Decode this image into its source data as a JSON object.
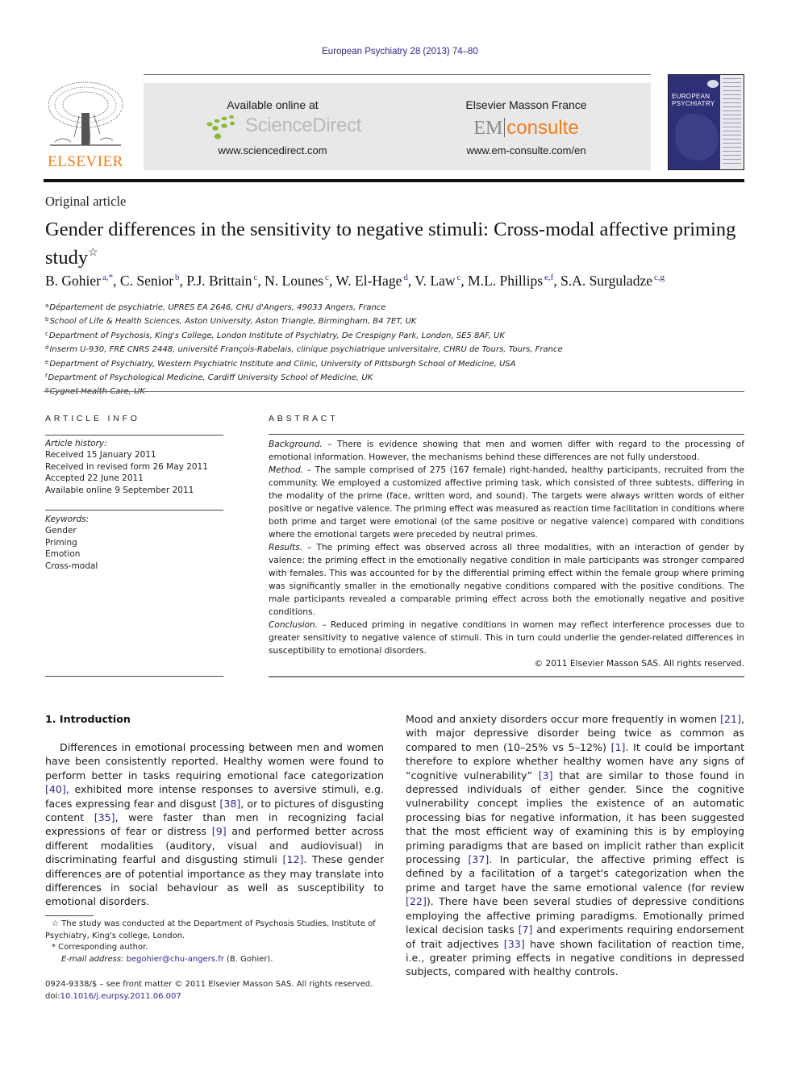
{
  "header": {
    "journal_ref": "European Psychiatry 28 (2013) 74–80",
    "publisher_logo_text": "ELSEVIER",
    "sciencedirect": {
      "available_label": "Available online at",
      "brand": "ScienceDirect",
      "url": "www.sciencedirect.com"
    },
    "emconsulte": {
      "publisher": "Elsevier Masson France",
      "brand_em": "EM",
      "brand_consulte": "consulte",
      "url": "www.em-consulte.com/en"
    },
    "cover": {
      "title_line1": "EUROPEAN",
      "title_line2": "PSYCHIATRY"
    },
    "colors": {
      "link": "#2a2a8c",
      "elsevier_orange": "#f07f1c",
      "banner_bg": "#e8e8e8",
      "cover_bg": "#2e2f77"
    }
  },
  "article": {
    "type": "Original article",
    "title": "Gender differences in the sensitivity to negative stimuli: Cross-modal affective priming study",
    "title_mark": "☆",
    "authors": [
      {
        "name": "B. Gohier",
        "sup": "a,*"
      },
      {
        "name": "C. Senior",
        "sup": "b"
      },
      {
        "name": "P.J. Brittain",
        "sup": "c"
      },
      {
        "name": "N. Lounes",
        "sup": "c"
      },
      {
        "name": "W. El-Hage",
        "sup": "d"
      },
      {
        "name": "V. Law",
        "sup": "c"
      },
      {
        "name": "M.L. Phillips",
        "sup": "e,f"
      },
      {
        "name": "S.A. Surguladze",
        "sup": "c,g"
      }
    ],
    "affiliations": [
      {
        "key": "a",
        "text": "Département de psychiatrie, UPRES EA 2646, CHU d'Angers, 49033 Angers, France"
      },
      {
        "key": "b",
        "text": "School of Life & Health Sciences, Aston University, Aston Triangle, Birmingham, B4 7ET, UK"
      },
      {
        "key": "c",
        "text": "Department of Psychosis, King's College, London Institute of Psychiatry, De Crespigny Park, London, SE5 8AF, UK"
      },
      {
        "key": "d",
        "text": "Inserm U-930, FRE CNRS 2448, université François-Rabelais, clinique psychiatrique universitaire, CHRU de Tours, Tours, France"
      },
      {
        "key": "e",
        "text": "Department of Psychiatry, Western Psychiatric Institute and Clinic, University of Pittsburgh School of Medicine, USA"
      },
      {
        "key": "f",
        "text": "Department of Psychological Medicine, Cardiff University School of Medicine, UK"
      },
      {
        "key": "g",
        "text": "Cygnet Health Care, UK"
      }
    ]
  },
  "article_info": {
    "heading": "ARTICLE INFO",
    "history_label": "Article history:",
    "history": [
      "Received 15 January 2011",
      "Received in revised form 26 May 2011",
      "Accepted 22 June 2011",
      "Available online 9 September 2011"
    ],
    "keywords_label": "Keywords:",
    "keywords": [
      "Gender",
      "Priming",
      "Emotion",
      "Cross-modal"
    ]
  },
  "abstract": {
    "heading": "ABSTRACT",
    "sections": [
      {
        "label": "Background.",
        "text": " – There is evidence showing that men and women differ with regard to the processing of emotional information. However, the mechanisms behind these differences are not fully understood."
      },
      {
        "label": "Method.",
        "text": " – The sample comprised of 275 (167 female) right-handed, healthy participants, recruited from the community. We employed a customized affective priming task, which consisted of three subtests, differing in the modality of the prime (face, written word, and sound). The targets were always written words of either positive or negative valence. The priming effect was measured as reaction time facilitation in conditions where both prime and target were emotional (of the same positive or negative valence) compared with conditions where the emotional targets were preceded by neutral primes."
      },
      {
        "label": "Results.",
        "text": " – The priming effect was observed across all three modalities, with an interaction of gender by valence: the priming effect in the emotionally negative condition in male participants was stronger compared with females. This was accounted for by the differential priming effect within the female group where priming was significantly smaller in the emotionally negative conditions compared with the positive conditions. The male participants revealed a comparable priming effect across both the emotionally negative and positive conditions."
      },
      {
        "label": "Conclusion.",
        "text": " – Reduced priming in negative conditions in women may reflect interference processes due to greater sensitivity to negative valence of stimuli. This in turn could underlie the gender-related differences in susceptibility to emotional disorders."
      }
    ],
    "copyright": "© 2011 Elsevier Masson SAS. All rights reserved."
  },
  "body": {
    "intro_heading": "1.  Introduction",
    "left_paragraph": [
      {
        "t": "Differences in emotional processing between men and women have been consistently reported. Healthy women were found to perform better in tasks requiring emotional face categorization "
      },
      {
        "ref": "[40]"
      },
      {
        "t": ", exhibited more intense responses to aversive stimuli, e.g. faces expressing fear and disgust "
      },
      {
        "ref": "[38]"
      },
      {
        "t": ", or to pictures of disgusting content "
      },
      {
        "ref": "[35]"
      },
      {
        "t": ", were faster than men in recognizing facial expressions of fear or distress "
      },
      {
        "ref": "[9]"
      },
      {
        "t": " and performed better across different modalities (auditory, visual and audiovisual) in discriminating fearful and disgusting stimuli "
      },
      {
        "ref": "[12]"
      },
      {
        "t": ". These gender differences are of potential importance as they may translate into differences in social behaviour as well as susceptibility to emotional disorders."
      }
    ],
    "right_paragraph": [
      {
        "t": "Mood and anxiety disorders occur more frequently in women "
      },
      {
        "ref": "[21]"
      },
      {
        "t": ", with major depressive disorder being twice as common as compared to men (10–25% vs 5–12%) "
      },
      {
        "ref": "[1]"
      },
      {
        "t": ". It could be important therefore to explore whether healthy women have any signs of “cognitive vulnerability” "
      },
      {
        "ref": "[3]"
      },
      {
        "t": " that are similar to those found in depressed individuals of either gender. Since the cognitive vulnerability concept implies the existence of an automatic processing bias for negative information, it has been suggested that the most efficient way of examining this is by employing priming paradigms that are based on implicit rather than explicit processing "
      },
      {
        "ref": "[37]"
      },
      {
        "t": ". In particular, the affective priming effect is defined by a facilitation of a target's categorization when the prime and target have the same emotional valence (for review "
      },
      {
        "ref": "[22]"
      },
      {
        "t": "). There have been several studies of depressive conditions employing the affective priming paradigms. Emotionally primed lexical decision tasks "
      },
      {
        "ref": "[7]"
      },
      {
        "t": " and experiments requiring endorsement of trait adjectives "
      },
      {
        "ref": "[33]"
      },
      {
        "t": " have shown facilitation of reaction time, i.e., greater priming effects in negative conditions in depressed subjects, compared with healthy controls."
      }
    ]
  },
  "footnotes": {
    "star_note": "☆ The study was conducted at the Department of Psychosis Studies, Institute of Psychiatry, King's college, London.",
    "corresponding": "* Corresponding author.",
    "email_label": "E-mail address:",
    "email": "begohier@chu-angers.fr",
    "email_suffix": " (B. Gohier).",
    "front_matter": "0924-9338/$ – see front matter © 2011 Elsevier Masson SAS. All rights reserved.",
    "doi_label": "doi:",
    "doi": "10.1016/j.eurpsy.2011.06.007"
  }
}
